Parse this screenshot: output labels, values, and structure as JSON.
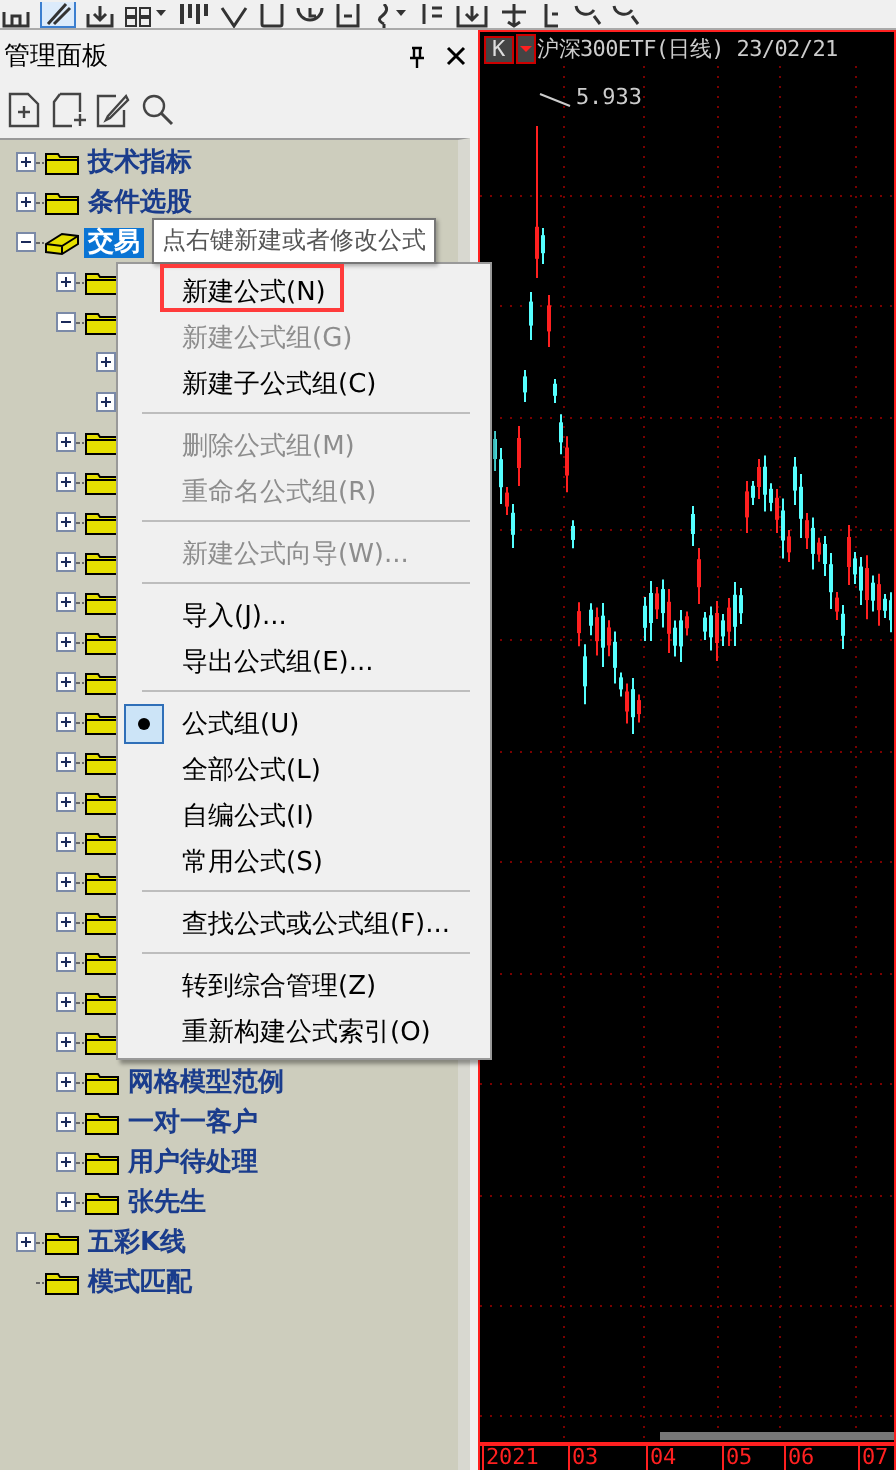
{
  "panel": {
    "title": "管理面板"
  },
  "tree": [
    {
      "label": "技术指标",
      "kind": "folder",
      "expanded": false,
      "selected": false
    },
    {
      "label": "条件选股",
      "kind": "folder",
      "expanded": false,
      "selected": false
    },
    {
      "label": "交易",
      "kind": "system",
      "expanded": true,
      "selected": true,
      "children": [
        {
          "kind": "folder",
          "expanded": false
        },
        {
          "kind": "folder",
          "expanded": true,
          "children": [
            {
              "expanded": false
            },
            {
              "expanded": false
            }
          ]
        },
        {
          "kind": "folder",
          "expanded": false
        },
        {
          "kind": "folder",
          "expanded": false
        },
        {
          "kind": "folder",
          "expanded": false
        },
        {
          "kind": "folder",
          "expanded": false
        },
        {
          "kind": "folder",
          "expanded": false
        },
        {
          "kind": "folder",
          "expanded": false
        },
        {
          "kind": "folder",
          "expanded": false
        },
        {
          "kind": "folder",
          "expanded": false
        },
        {
          "kind": "folder",
          "expanded": false
        },
        {
          "kind": "folder",
          "expanded": false
        },
        {
          "kind": "folder",
          "expanded": false
        },
        {
          "kind": "folder",
          "expanded": false
        },
        {
          "kind": "folder",
          "expanded": false
        },
        {
          "kind": "folder",
          "expanded": false
        },
        {
          "kind": "folder",
          "expanded": false
        },
        {
          "kind": "folder",
          "expanded": false
        },
        {
          "label": "网格模型范例",
          "kind": "folder",
          "expanded": false,
          "selected": false
        },
        {
          "label": "一对一客户",
          "kind": "folder",
          "expanded": false,
          "selected": false
        },
        {
          "label": "用户待处理",
          "kind": "folder",
          "expanded": false,
          "selected": false
        },
        {
          "label": "张先生",
          "kind": "folder",
          "expanded": false,
          "selected": false
        }
      ]
    },
    {
      "label": "五彩K线",
      "kind": "folder",
      "expanded": false,
      "selected": false
    },
    {
      "label": "模式匹配",
      "kind": "folder",
      "selected": false
    }
  ],
  "menu": {
    "items": [
      {
        "kind": "item",
        "label": "新建公式(N)",
        "disabled": false
      },
      {
        "kind": "item",
        "label": "新建公式组(G)",
        "disabled": true
      },
      {
        "kind": "item",
        "label": "新建子公式组(C)",
        "disabled": false
      },
      {
        "kind": "separator"
      },
      {
        "kind": "item",
        "label": "删除公式组(M)",
        "disabled": true
      },
      {
        "kind": "item",
        "label": "重命名公式组(R)",
        "disabled": true
      },
      {
        "kind": "separator"
      },
      {
        "kind": "item",
        "label": "新建公式向导(W)...",
        "disabled": true
      },
      {
        "kind": "separator"
      },
      {
        "kind": "item",
        "label": "导入(J)...",
        "disabled": false
      },
      {
        "kind": "item",
        "label": "导出公式组(E)...",
        "disabled": false
      },
      {
        "kind": "separator"
      },
      {
        "kind": "radio",
        "label": "公式组(U)",
        "disabled": false,
        "selected": true
      },
      {
        "kind": "radio",
        "label": "全部公式(L)",
        "disabled": false,
        "selected": false
      },
      {
        "kind": "radio",
        "label": "自编公式(I)",
        "disabled": false,
        "selected": false
      },
      {
        "kind": "radio",
        "label": "常用公式(S)",
        "disabled": false,
        "selected": false
      },
      {
        "kind": "separator"
      },
      {
        "kind": "item",
        "label": "查找公式或公式组(F)...",
        "disabled": false
      },
      {
        "kind": "separator"
      },
      {
        "kind": "item",
        "label": "转到综合管理(Z)",
        "disabled": false
      },
      {
        "kind": "item",
        "label": "重新构建公式索引(O)",
        "disabled": false
      }
    ]
  },
  "tooltip": "点右键新建或者修改公式",
  "chart": {
    "period_button": "K",
    "title": "沪深300ETF(日线) 23/02/21",
    "peak_label": "5.933",
    "x_labels": [
      "2021",
      "03",
      "04",
      "05",
      "06",
      "07"
    ]
  }
}
